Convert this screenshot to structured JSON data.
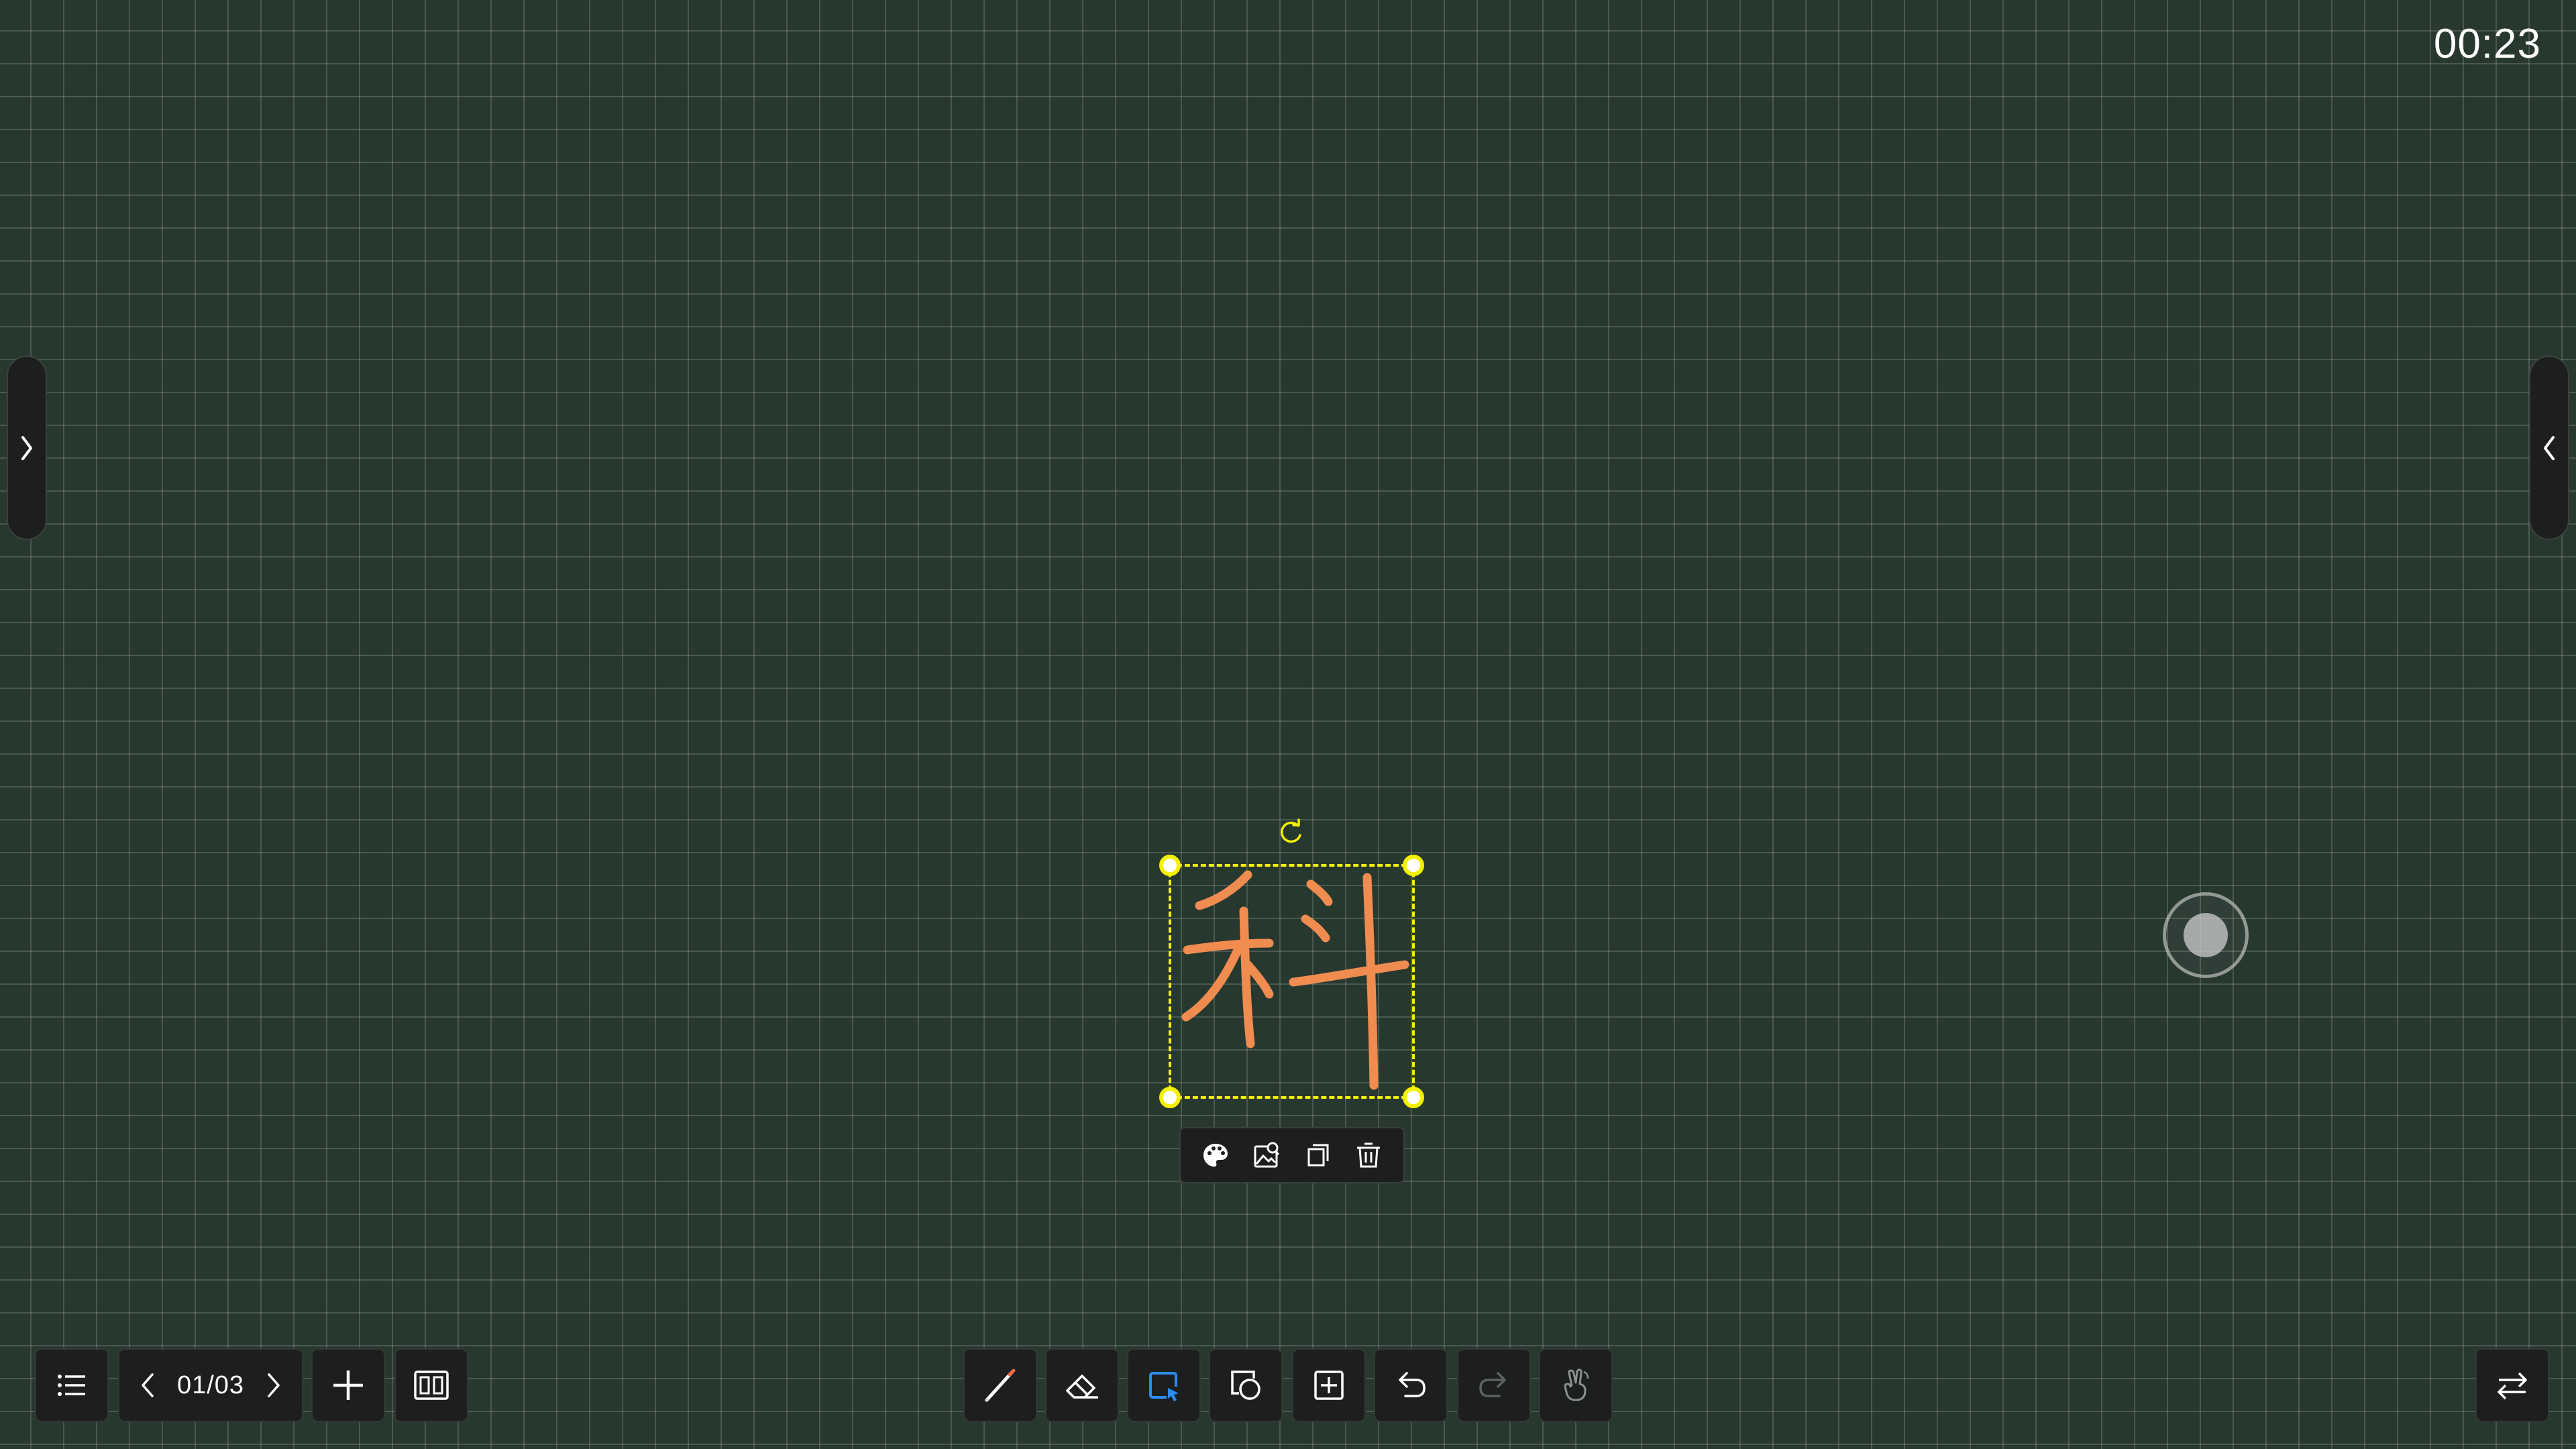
{
  "timer": "00:23",
  "pagination": {
    "current_display": "01/03"
  },
  "drawing": {
    "character": "科",
    "stroke_color": "#f08c50"
  },
  "colors": {
    "background": "#27382f",
    "selection": "#f3f000",
    "toolbar_bg": "#1c1f1e",
    "active_tool": "#2c8cf2",
    "icon": "#ffffff"
  },
  "selection_toolbar": {
    "icons": [
      "palette-icon",
      "save-image-icon",
      "copy-icon",
      "delete-icon"
    ]
  },
  "bottom_left": {
    "icons": [
      "menu-icon",
      "prev-page-icon",
      "next-page-icon",
      "add-page-icon",
      "page-overview-icon"
    ]
  },
  "tools": [
    {
      "name": "pen-icon",
      "active": false
    },
    {
      "name": "eraser-icon",
      "active": false
    },
    {
      "name": "select-icon",
      "active": true
    },
    {
      "name": "shapes-icon",
      "active": false
    },
    {
      "name": "insert-icon",
      "active": false
    },
    {
      "name": "undo-icon",
      "active": false
    },
    {
      "name": "redo-icon",
      "active": false,
      "disabled": true
    },
    {
      "name": "gesture-icon",
      "active": false
    }
  ],
  "bottom_right": {
    "icons": [
      "switch-icon"
    ]
  },
  "side_handles": {
    "left": "expand-right-icon",
    "right": "expand-left-icon"
  },
  "floating_ball": "floating-ball-icon"
}
